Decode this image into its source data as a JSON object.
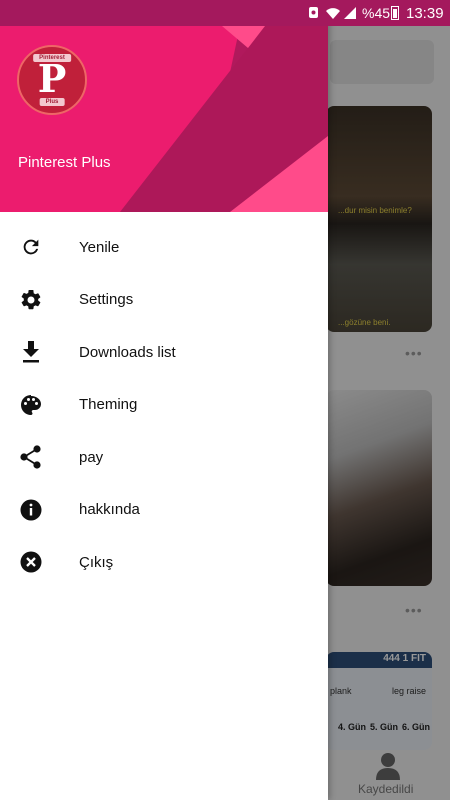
{
  "status_bar": {
    "battery_percent": "%45",
    "time": "13:39",
    "icons": [
      "notification-icon",
      "wifi-icon",
      "signal-icon",
      "battery-icon"
    ]
  },
  "drawer": {
    "header": {
      "app_name": "Pinterest Plus",
      "logo_top_text": "Pinterest",
      "logo_bottom_text": "Plus",
      "colors": {
        "primary": "#ec1c6e",
        "dark": "#a4195d"
      }
    },
    "menu": [
      {
        "label": "Yenile",
        "icon": "refresh-icon"
      },
      {
        "label": "Settings",
        "icon": "gear-icon"
      },
      {
        "label": "Downloads list",
        "icon": "download-icon"
      },
      {
        "label": "Theming",
        "icon": "palette-icon"
      },
      {
        "label": "pay",
        "icon": "share-icon"
      },
      {
        "label": "hakkında",
        "icon": "info-icon"
      },
      {
        "label": "Çıkış",
        "icon": "close-circle-icon"
      }
    ]
  },
  "background": {
    "pin1_captions": [
      "...dur misin benimle?",
      "...gözüne beni."
    ],
    "pin3_header": "444 1 FIT",
    "pin3_labels": [
      "plank",
      "leg raise",
      "4. Gün",
      "5. Gün",
      "6. Gün"
    ],
    "bottom_nav_label": "Kaydedildi"
  }
}
